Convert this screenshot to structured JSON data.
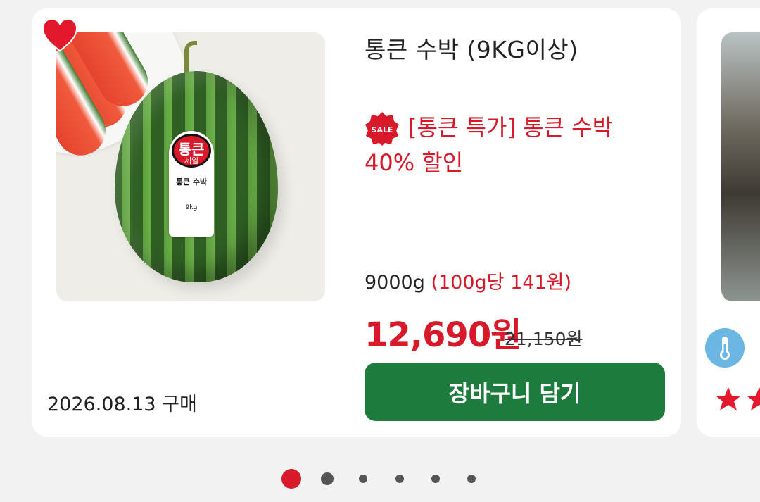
{
  "product": {
    "title": "통큰 수박 (9KG이상)",
    "sale_badge": "SALE",
    "promo": "[통큰 특가] 통큰 수박 40% 할인",
    "weight": "9000g",
    "unit_price": "(100g당 141원)",
    "price": "12,690원",
    "original_price": "21,150원",
    "purchase_date": "2026.08.13 구매",
    "cart_button": "장바구니 담기",
    "wishlisted": true,
    "sticker": {
      "brand": "통큰",
      "sub": "세일",
      "name": "통큰 수박",
      "weight": "9kg"
    }
  },
  "icons": {
    "heart": "heart-icon",
    "sale": "sale-badge-icon",
    "thermometer": "thermometer-icon",
    "star": "star-icon"
  },
  "colors": {
    "accent_red": "#d7192a",
    "button_green": "#1e7b3e",
    "thermo_blue": "#6bb6e3"
  },
  "pagination": {
    "count": 6,
    "active_index": 0
  }
}
